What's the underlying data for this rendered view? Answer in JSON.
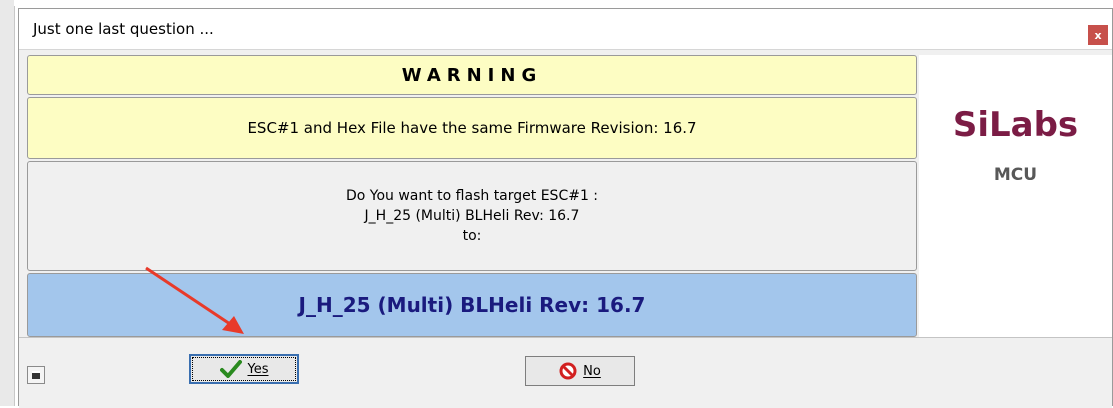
{
  "dialog": {
    "title": "Just one last question ...",
    "close_label": "x"
  },
  "panels": {
    "warning": "WARNING",
    "same_revision": "ESC#1 and Hex File have the same Firmware Revision: 16.7",
    "question_lines": [
      "Do You want to flash target ESC#1 :",
      "J_H_25 (Multi) BLHeli Rev: 16.7",
      "to:"
    ],
    "target": "J_H_25 (Multi) BLHeli Rev: 16.7"
  },
  "brand": {
    "name": "SiLabs",
    "sub": "MCU",
    "color": "#7b1c45"
  },
  "buttons": {
    "yes_label": "Yes",
    "no_label": "No",
    "yes_icon": "checkmark-icon",
    "no_icon": "no-entry-icon"
  },
  "annotation": {
    "arrow_color": "#e83a2a"
  }
}
